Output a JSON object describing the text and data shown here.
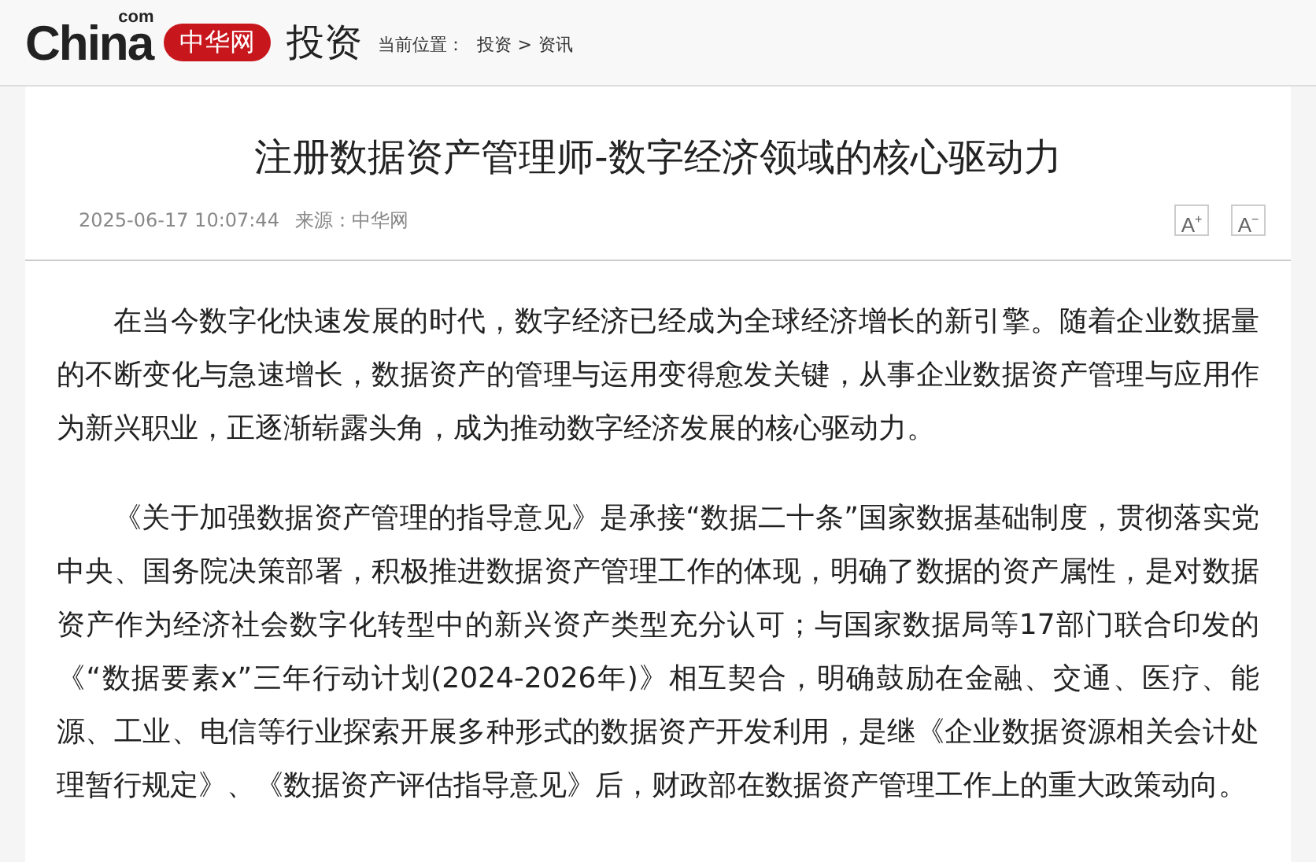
{
  "header": {
    "logo": {
      "brand": "China",
      "suffix": "com",
      "badge": "中华网"
    },
    "channel": "投资",
    "breadcrumb": {
      "label": "当前位置：",
      "items": [
        "投资",
        "资讯"
      ],
      "separator": ">"
    }
  },
  "article": {
    "title": "注册数据资产管理师-数字经济领域的核心驱动力",
    "date": "2025-06-17 10:07:44",
    "source": "来源：中华网",
    "font_buttons": [
      {
        "label": "A",
        "sup": "+"
      },
      {
        "label": "A",
        "sup": "−"
      }
    ],
    "paragraphs": [
      "在当今数字化快速发展的时代，数字经济已经成为全球经济增长的新引擎。随着企业数据量的不断变化与急速增长，数据资产的管理与运用变得愈发关键，从事企业数据资产管理与应用作为新兴职业，正逐渐崭露头角，成为推动数字经济发展的核心驱动力。",
      "《关于加强数据资产管理的指导意见》是承接“数据二十条”国家数据基础制度，贯彻落实党中央、国务院决策部署，积极推进数据资产管理工作的体现，明确了数据的资产属性，是对数据资产作为经济社会数字化转型中的新兴资产类型充分认可；与国家数据局等17部门联合印发的《“数据要素x”三年行动计划(2024-2026年)》相互契合，明确鼓励在金融、交通、医疗、能源、工业、电信等行业探索开展多种形式的数据资产开发利用，是继《企业数据资源相关会计处理暂行规定》、《数据资产评估指导意见》后，财政部在数据资产管理工作上的重大政策动向。"
    ]
  }
}
